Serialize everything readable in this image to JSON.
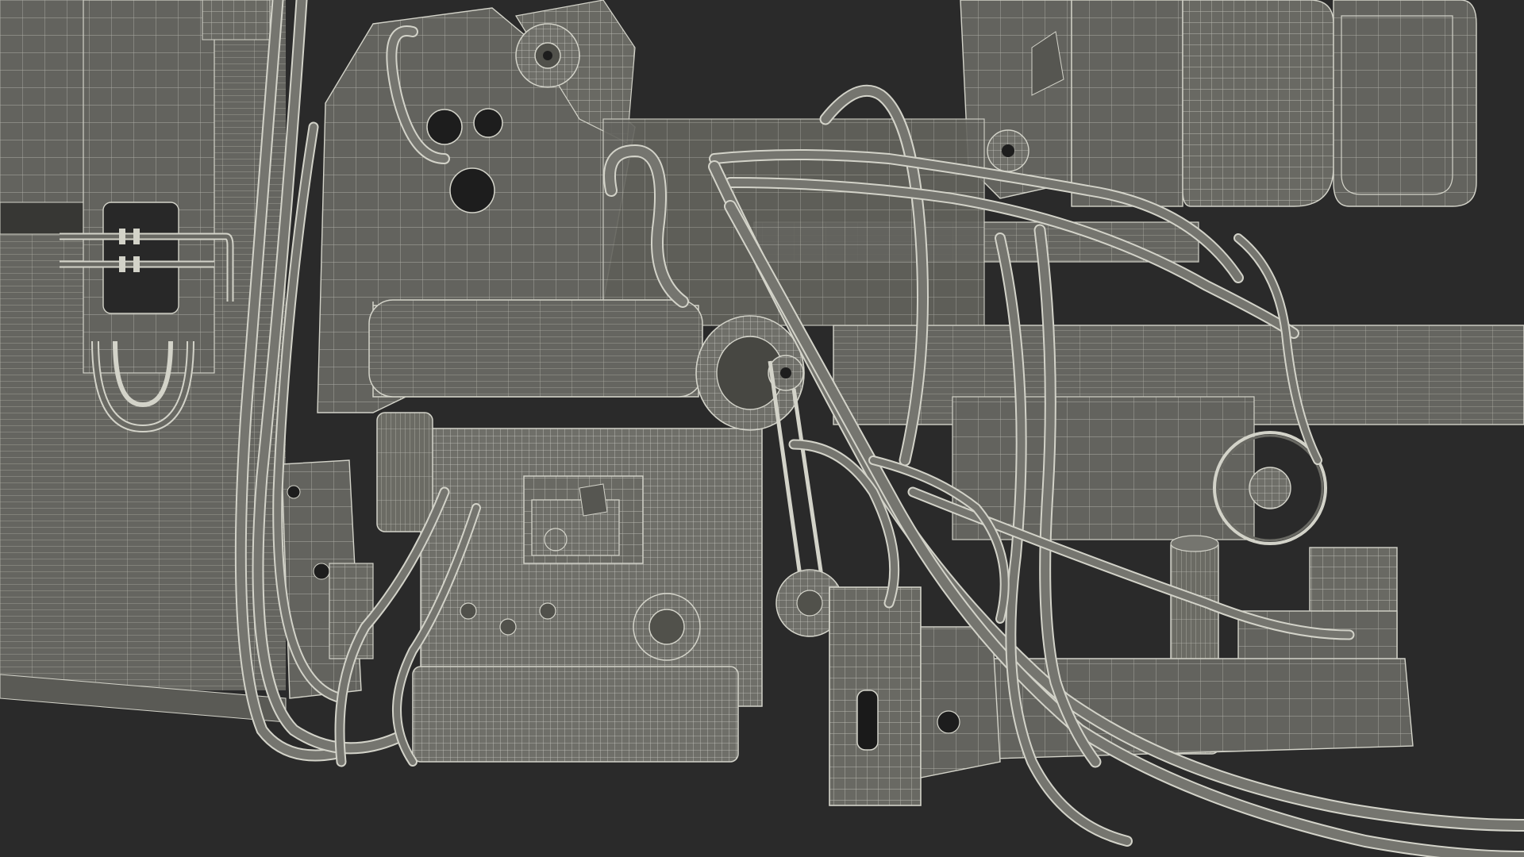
{
  "scene": {
    "subject": "wireframe-machinery-render",
    "colors": {
      "background": "#2c2c2c",
      "surface": "#6e6e68",
      "surface_light": "#7c7c76",
      "surface_dark": "#565652",
      "wire": "#dcdcd2",
      "hole": "#1c1c1c"
    }
  }
}
